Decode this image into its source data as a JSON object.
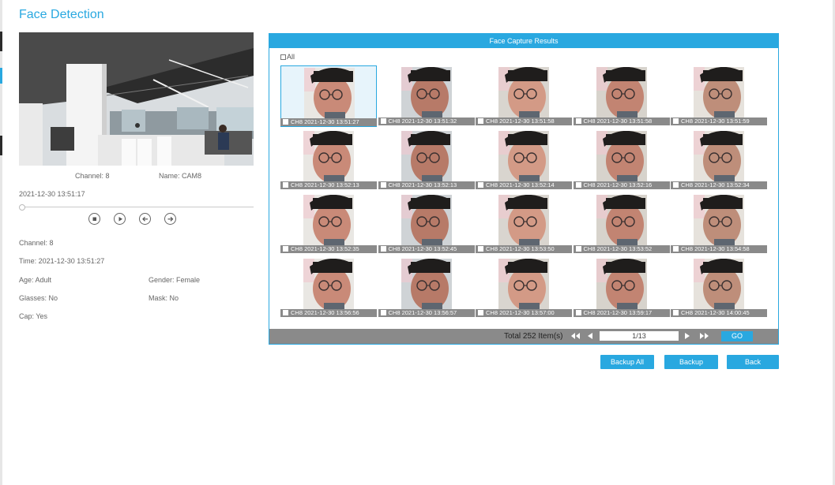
{
  "page": {
    "title": "Face Detection"
  },
  "preview": {
    "channel": "Channel: 8",
    "name": "Name: CAM8",
    "timestamp": "2021-12-30 13:51:17",
    "progress": 0.0
  },
  "details": {
    "channel": "Channel: 8",
    "time": "Time: 2021-12-30 13:51:27",
    "age": "Age: Adult",
    "gender": "Gender: Female",
    "glasses": "Glasses: No",
    "mask": "Mask: No",
    "cap": "Cap: Yes"
  },
  "results": {
    "header": "Face Capture Results",
    "select_all": "All",
    "items": [
      {
        "label": "CH8 2021-12-30 13:51:27",
        "selected": true
      },
      {
        "label": "CH8 2021-12-30 13:51:32"
      },
      {
        "label": "CH8 2021-12-30 13:51:58"
      },
      {
        "label": "CH8 2021-12-30 13:51:58"
      },
      {
        "label": "CH8 2021-12-30 13:51:59"
      },
      {
        "label": "CH8 2021-12-30 13:52:13"
      },
      {
        "label": "CH8 2021-12-30 13:52:13"
      },
      {
        "label": "CH8 2021-12-30 13:52:14"
      },
      {
        "label": "CH8 2021-12-30 13:52:16"
      },
      {
        "label": "CH8 2021-12-30 13:52:34"
      },
      {
        "label": "CH8 2021-12-30 13:52:35"
      },
      {
        "label": "CH8 2021-12-30 13:52:45"
      },
      {
        "label": "CH8 2021-12-30 13:53:50"
      },
      {
        "label": "CH8 2021-12-30 13:53:52"
      },
      {
        "label": "CH8 2021-12-30 13:54:58"
      },
      {
        "label": "CH8 2021-12-30 13:56:56"
      },
      {
        "label": "CH8 2021-12-30 13:56:57"
      },
      {
        "label": "CH8 2021-12-30 13:57:00"
      },
      {
        "label": "CH8 2021-12-30 13:59:17"
      },
      {
        "label": "CH8 2021-12-30 14:00:45"
      }
    ]
  },
  "pagination": {
    "total": "Total 252 Item(s)",
    "page": "1/13",
    "go": "GO"
  },
  "actions": {
    "backup_all": "Backup All",
    "backup": "Backup",
    "back": "Back"
  },
  "icons": {
    "stop": "stop-icon",
    "play": "play-icon",
    "prev": "step-back-icon",
    "next": "step-forward-icon",
    "first": "first-page-icon",
    "prev_page": "prev-page-icon",
    "next_page": "next-page-icon",
    "last": "last-page-icon"
  },
  "colors": {
    "accent": "#29a8e0",
    "pager": "#8a8a8a"
  }
}
